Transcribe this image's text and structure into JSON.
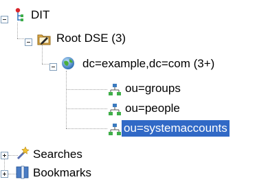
{
  "tree": {
    "dit_label": "DIT",
    "root_dse_label": "Root DSE (3)",
    "domain_label": "dc=example,dc=com (3+)",
    "children": [
      {
        "label": "ou=groups"
      },
      {
        "label": "ou=people"
      },
      {
        "label": "ou=systemaccounts"
      }
    ],
    "searches_label": "Searches",
    "bookmarks_label": "Bookmarks"
  },
  "colors": {
    "selection": "#3169c6",
    "folder": "#e8b04a",
    "globe": "#4a90c8"
  }
}
